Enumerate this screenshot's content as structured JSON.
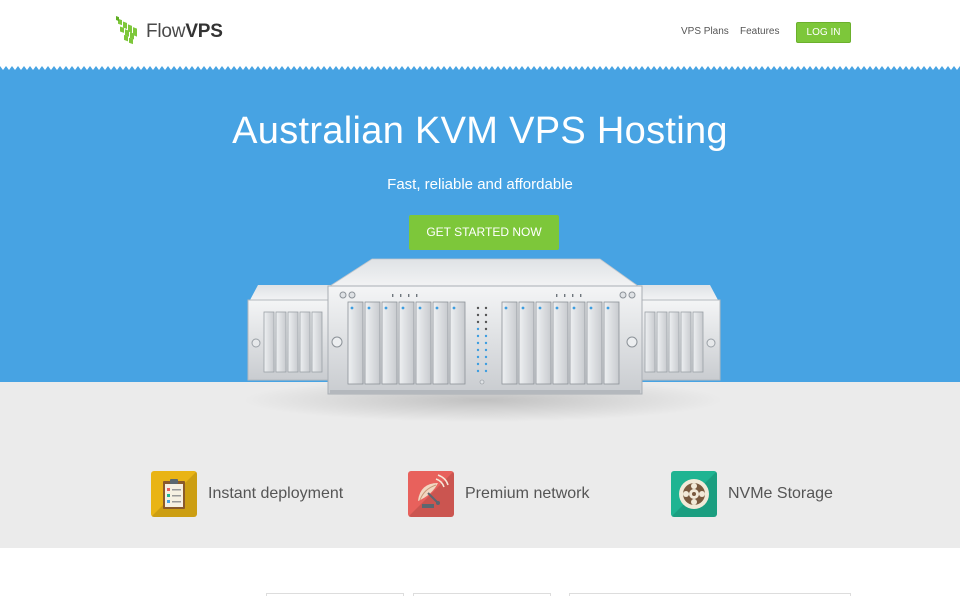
{
  "header": {
    "logo_light": "Flow",
    "logo_bold": "VPS",
    "nav": {
      "plans": "VPS Plans",
      "features": "Features",
      "login": "LOG IN"
    }
  },
  "hero": {
    "title": "Australian KVM VPS Hosting",
    "subtitle": "Fast, reliable and affordable",
    "cta": "GET STARTED NOW"
  },
  "features": [
    {
      "label": "Instant deployment",
      "icon": "clipboard-icon",
      "color": "#e9b415"
    },
    {
      "label": "Premium network",
      "icon": "satellite-dish-icon",
      "color": "#e8615c"
    },
    {
      "label": "NVMe Storage",
      "icon": "disk-icon",
      "color": "#1fb492"
    }
  ],
  "colors": {
    "hero_blue": "#47a3e3",
    "accent_green": "#7dc73a",
    "band_gray": "#ebebeb"
  }
}
